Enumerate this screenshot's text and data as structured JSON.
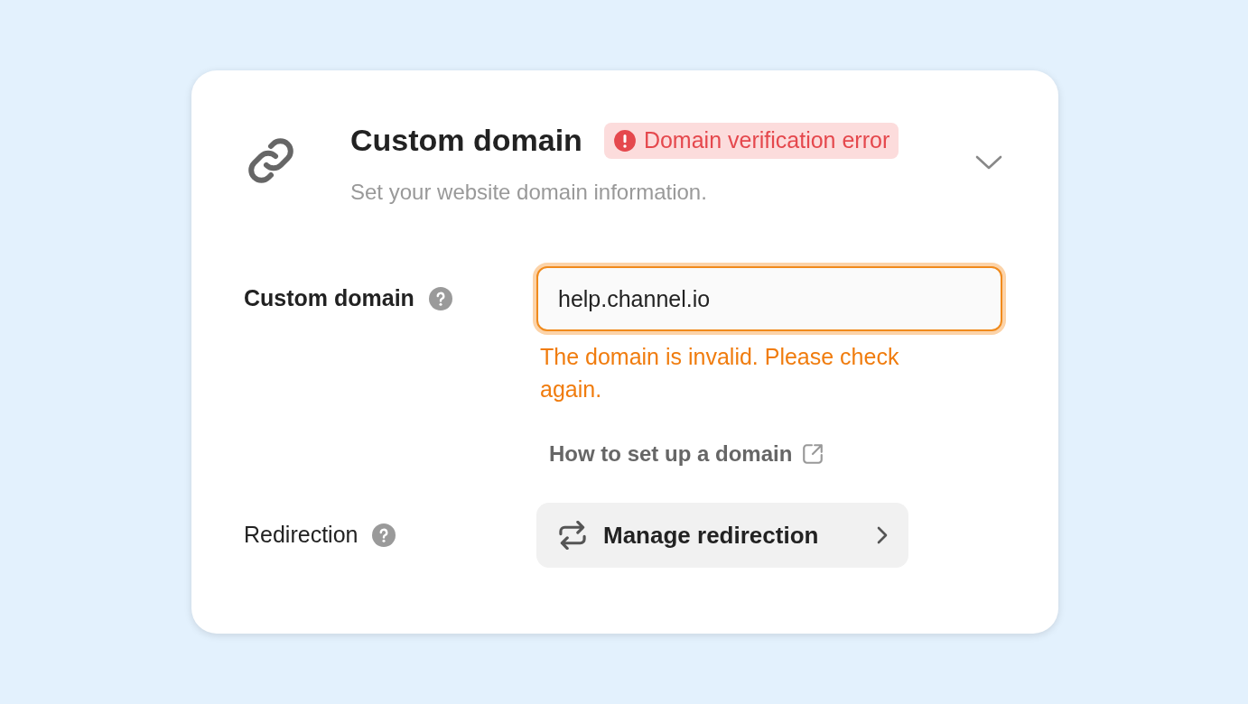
{
  "header": {
    "title": "Custom domain",
    "badge": {
      "text": "Domain verification error",
      "kind": "error"
    },
    "subtitle": "Set your website domain information."
  },
  "rows": [
    {
      "kind": "input",
      "label": "Custom domain",
      "bold": true,
      "value": "help.channel.io",
      "invalid": true,
      "error": "The domain is invalid. Please check again.",
      "link": "How to set up a domain"
    },
    {
      "kind": "button",
      "label": "Redirection",
      "bold": false,
      "button": "Manage redirection"
    }
  ]
}
